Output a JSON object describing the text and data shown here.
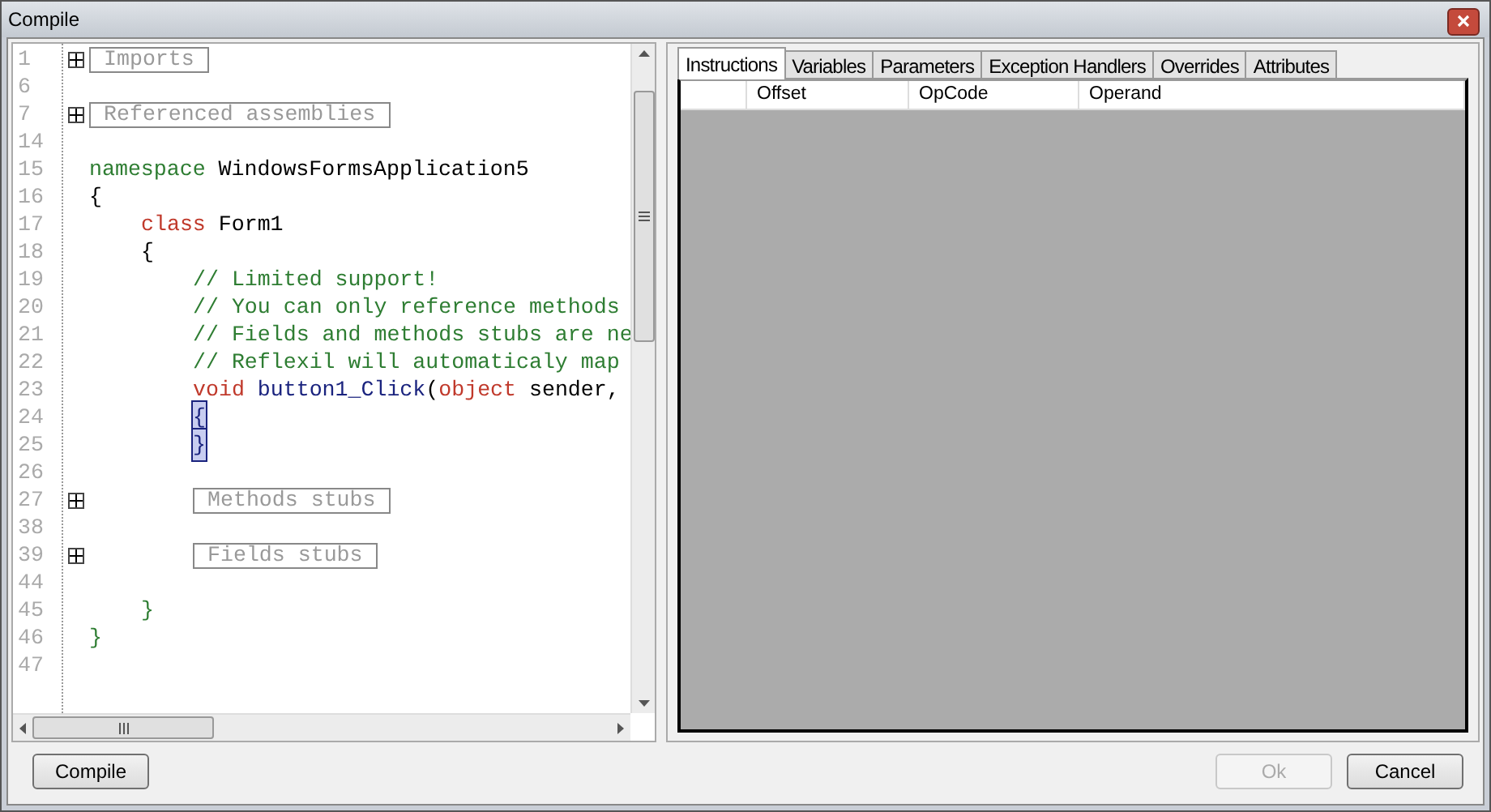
{
  "window": {
    "title": "Compile"
  },
  "code_lines": [
    {
      "number": "1",
      "foldable": true,
      "segments": [
        {
          "kind": "region",
          "text": "Imports"
        }
      ]
    },
    {
      "number": "6",
      "foldable": false
    },
    {
      "number": "7",
      "foldable": true,
      "segments": [
        {
          "kind": "region",
          "text": "Referenced assemblies"
        }
      ]
    },
    {
      "number": "14",
      "foldable": false
    },
    {
      "number": "15",
      "foldable": false,
      "segments": [
        {
          "kind": "keyword",
          "text": "namespace"
        },
        {
          "kind": "plain",
          "text": " WindowsFormsApplication5"
        }
      ]
    },
    {
      "number": "16",
      "foldable": false,
      "segments": [
        {
          "kind": "plain",
          "text": "{"
        }
      ],
      "children": [
        {
          "number": "17",
          "foldable": false,
          "segments": [
            {
              "kind": "type",
              "text": "class"
            },
            {
              "kind": "plain",
              "text": " Form1"
            }
          ]
        },
        {
          "number": "18",
          "foldable": false,
          "segments": [
            {
              "kind": "plain",
              "text": "{"
            }
          ],
          "children": [
            {
              "number": "19",
              "foldable": false,
              "segments": [
                {
                  "kind": "comment",
                  "text": "// Limited support!"
                }
              ]
            },
            {
              "number": "20",
              "foldable": false,
              "segments": [
                {
                  "kind": "comment",
                  "text": "// You can only reference methods"
                }
              ]
            },
            {
              "number": "21",
              "foldable": false,
              "segments": [
                {
                  "kind": "comment",
                  "text": "// Fields and methods stubs are ne"
                }
              ]
            },
            {
              "number": "22",
              "foldable": false,
              "segments": [
                {
                  "kind": "comment",
                  "text": "// Reflexil will automaticaly map"
                }
              ]
            },
            {
              "number": "23",
              "foldable": false,
              "segments": [
                {
                  "kind": "type",
                  "text": "void"
                },
                {
                  "kind": "method",
                  "text": " button1_Click"
                },
                {
                  "kind": "plain",
                  "text": "("
                },
                {
                  "kind": "type",
                  "text": "object"
                },
                {
                  "kind": "plain",
                  "text": " sender,"
                }
              ]
            },
            {
              "number": "24",
              "foldable": false,
              "segments": [
                {
                  "kind": "match",
                  "text": "{"
                }
              ]
            },
            {
              "number": "25",
              "foldable": false,
              "segments": [
                {
                  "kind": "match",
                  "text": "}"
                }
              ]
            },
            {
              "number": "26",
              "foldable": false
            },
            {
              "number": "27",
              "foldable": true,
              "segments": [
                {
                  "kind": "region",
                  "text": "Methods stubs"
                }
              ]
            },
            {
              "number": "38",
              "foldable": false
            },
            {
              "number": "39",
              "foldable": true,
              "segments": [
                {
                  "kind": "region",
                  "text": "Fields stubs"
                }
              ]
            },
            {
              "number": "44",
              "foldable": false
            }
          ]
        },
        {
          "number": "45",
          "foldable": false,
          "segments": [
            {
              "kind": "brace",
              "text": "}"
            }
          ]
        }
      ]
    },
    {
      "number": "46",
      "foldable": false,
      "segments": [
        {
          "kind": "brace",
          "text": "}"
        }
      ]
    },
    {
      "number": "47",
      "foldable": false
    }
  ],
  "tabs": [
    {
      "label": "Instructions",
      "selected": true
    },
    {
      "label": "Variables",
      "selected": false
    },
    {
      "label": "Parameters",
      "selected": false
    },
    {
      "label": "Exception Handlers",
      "selected": false
    },
    {
      "label": "Overrides",
      "selected": false
    },
    {
      "label": "Attributes",
      "selected": false
    }
  ],
  "table": {
    "columns": [
      "Offset",
      "OpCode",
      "Operand"
    ]
  },
  "buttons": [
    {
      "label": "Compile",
      "disabled": false
    },
    {
      "label": "Ok",
      "disabled": true
    },
    {
      "label": "Cancel",
      "disabled": false
    }
  ]
}
